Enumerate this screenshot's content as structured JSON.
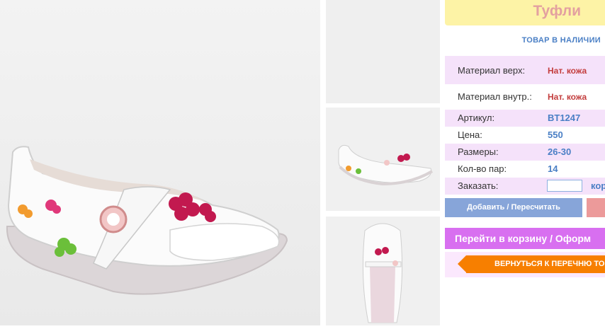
{
  "product": {
    "title": "Туфли",
    "stock_label": "ТОВАР В НАЛИЧИИ"
  },
  "specs": {
    "material_top_label": "Материал верх:",
    "material_top_value": "Нат. кожа",
    "material_inner_label": "Материал внутр.:",
    "material_inner_value": "Нат. кожа",
    "article_label": "Артикул:",
    "article_value": "BT1247",
    "price_label": "Цена:",
    "price_value": "550",
    "sizes_label": "Размеры:",
    "sizes_value": "26-30",
    "pairs_label": "Кол-во пар:",
    "pairs_value": "14",
    "order_label": "Заказать:",
    "order_value": "",
    "order_suffix": "кор"
  },
  "buttons": {
    "add": "Добавить / Пересчитать",
    "cart": "Перейти в корзину / Оформ",
    "back": "ВЕРНУТЬСЯ К ПЕРЕЧНЮ ТО"
  },
  "colors": {
    "title_bg": "#fdf3a6",
    "row_pink": "#f5e2fa",
    "accent_blue": "#4a7fc5",
    "accent_red": "#c33d3d",
    "cart_button": "#d86ff0",
    "back_button": "#f77f00"
  }
}
